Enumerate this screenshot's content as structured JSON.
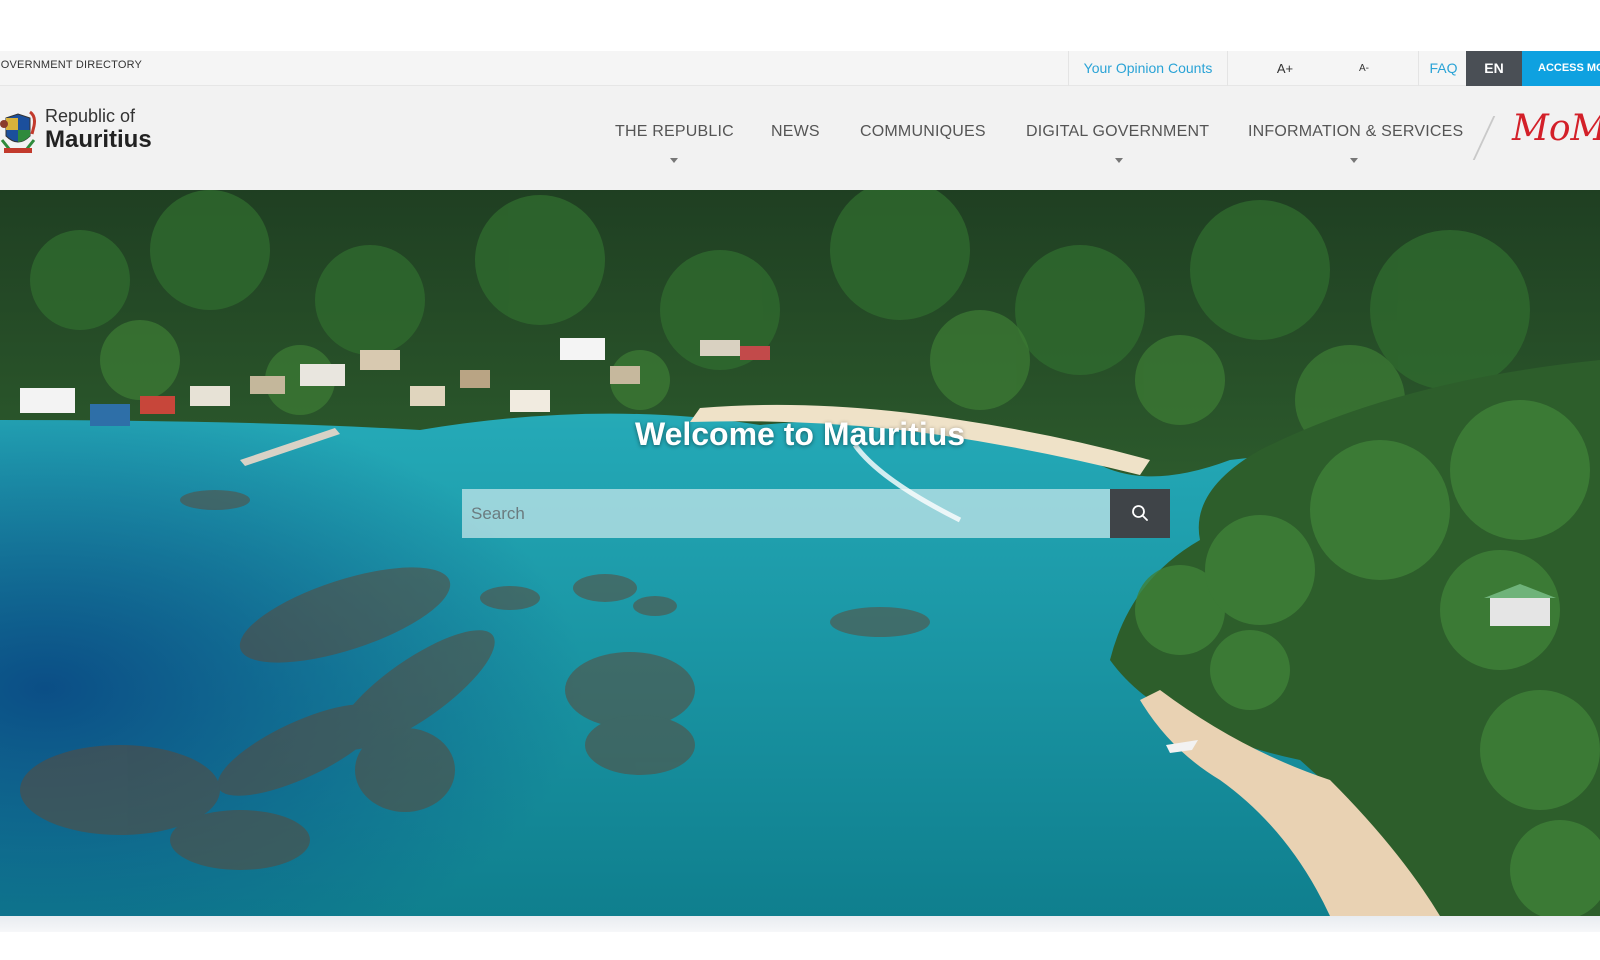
{
  "topbar": {
    "government_directory": "GOVERNMENT DIRECTORY",
    "opinion": "Your Opinion Counts",
    "font_increase": "A+",
    "font_decrease": "A-",
    "faq": "FAQ",
    "language": "EN",
    "access": "ACCESS MODE"
  },
  "header": {
    "logo_line1": "Republic of",
    "logo_line2": "Mauritius",
    "nav": [
      {
        "label": "THE REPUBLIC",
        "has_dropdown": true
      },
      {
        "label": "NEWS",
        "has_dropdown": false
      },
      {
        "label": "COMMUNIQUES",
        "has_dropdown": false
      },
      {
        "label": "DIGITAL GOVERNMENT",
        "has_dropdown": true
      },
      {
        "label": "INFORMATION & SERVICES",
        "has_dropdown": true
      }
    ],
    "momo_logo": "MoMo"
  },
  "hero": {
    "welcome": "Welcome to Mauritius",
    "search_placeholder": "Search"
  },
  "colors": {
    "accent_blue": "#2aa3d6",
    "access_blue": "#0ea1e0",
    "lang_dark": "#4a4f55",
    "momo_red": "#d32029"
  },
  "icons": [
    "crest-icon",
    "search-icon",
    "caret-down-icon"
  ]
}
